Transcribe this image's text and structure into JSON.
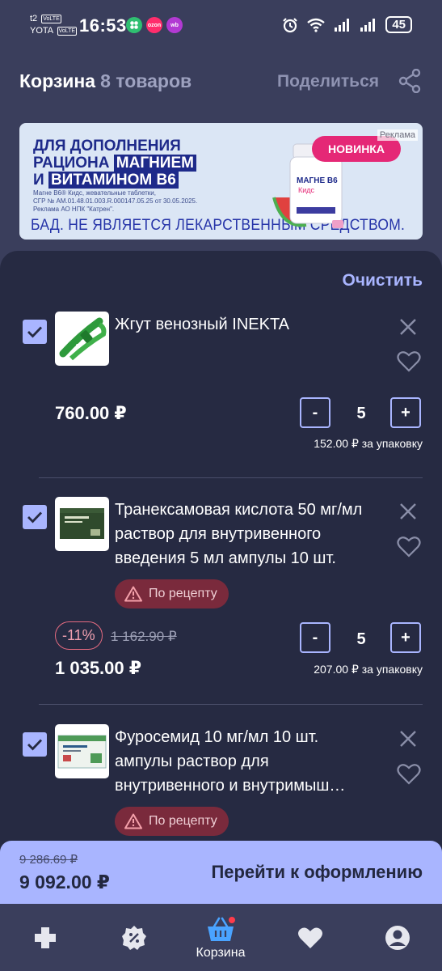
{
  "status_bar": {
    "carrier1": "t2",
    "carrier2": "YOTA",
    "volte": "VoLTE",
    "time": "16:53",
    "app_icons": [
      "ozon",
      "wb"
    ],
    "battery": "45"
  },
  "header": {
    "title": "Корзина",
    "count": "8 товаров",
    "share_label": "Поделиться"
  },
  "banner": {
    "headline_line1": "ДЛЯ ДОПОЛНЕНИЯ",
    "headline_line2a": "РАЦИОНА",
    "headline_line2b": "МАГНИЕМ",
    "headline_line3a": "И",
    "headline_line3b": "ВИТАМИНОМ В6",
    "fine_line1": "Магне В6® Кидс, жевательные таблетки,",
    "fine_line2": "СГР № AM.01.48.01.003.R.000147.05.25 от 30.05.2025.",
    "fine_line3": "Реклама АО НПК \"Катрен\".",
    "disclaimer": "БАД. НЕ ЯВЛЯЕТСЯ ЛЕКАРСТВЕННЫМ СРЕДСТВОМ.",
    "new_badge": "НОВИНКА",
    "ad_label": "Реклама",
    "product_label": "МАГНЕ В6",
    "product_sub": "Кидс"
  },
  "cart": {
    "clear_label": "Очистить",
    "items": [
      {
        "name": "Жгут венозный INEKTA",
        "price": "760.00 ₽",
        "qty": "5",
        "per_pack": "152.00 ₽ за упаковку"
      },
      {
        "name": "Транексамовая кислота 50 мг/мл раствор для внутривенного введения 5 мл ампулы 10 шт.",
        "rx_label": "По рецепту",
        "discount": "-11%",
        "old_price": "1 162.90 ₽",
        "price": "1 035.00 ₽",
        "qty": "5",
        "per_pack": "207.00 ₽ за упаковку"
      },
      {
        "name_line1": "Фуросемид 10 мг/мл 10 шт.",
        "name_line2": "ампулы раствор для",
        "name_line3": "внутривенного и внутримыш…",
        "rx_label": "По рецепту"
      }
    ],
    "qty_minus": "-",
    "qty_plus": "+"
  },
  "checkout": {
    "old_total": "9 286.69 ₽",
    "total": "9 092.00 ₽",
    "button_label": "Перейти к оформлению"
  },
  "bottom_nav": {
    "cart_label": "Корзина"
  },
  "colors": {
    "background": "#3a3e5c",
    "panel": "#262a42",
    "accent": "#a9b5ff",
    "rx_badge": "#7a2a3c"
  }
}
